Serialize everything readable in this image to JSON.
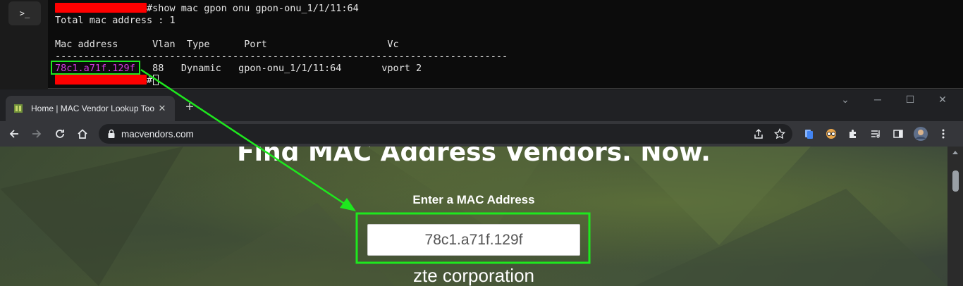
{
  "terminal": {
    "tab_icon": ">_",
    "prompt_cmd": "#show mac gpon onu gpon-onu_1/1/11:64",
    "total_line": "Total mac address : 1",
    "table_header": "Mac address      Vlan  Type      Port                     Vc",
    "separator": "-------------------------------------------------------------------------------",
    "row": {
      "mac": "78c1.a71f.129f",
      "rest": "   88   Dynamic   gpon-onu_1/1/11:64       vport 2"
    },
    "prompt_hash": "#",
    "redaction_color": "#ff0000"
  },
  "browser": {
    "tab": {
      "title": "Home | MAC Vendor Lookup Too",
      "close": "✕"
    },
    "new_tab": "+",
    "address": "macvendors.com",
    "window_controls": {
      "down": "⌄",
      "minimize": "─",
      "maximize": "☐",
      "close": "✕"
    }
  },
  "page": {
    "headline": "Find MAC Address Vendors. Now.",
    "input_label": "Enter a MAC Address",
    "input_value": "78c1.a71f.129f",
    "result": "zte corporation"
  },
  "annotation": {
    "highlight_color": "#1ee81e",
    "mac_highlight_color": "#d63be3"
  }
}
